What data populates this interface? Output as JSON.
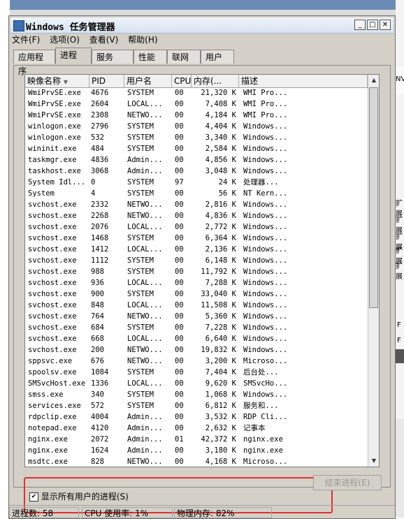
{
  "window": {
    "title": "Windows 任务管理器",
    "controls": {
      "minimize": "_",
      "maximize": "□",
      "close": "✕"
    }
  },
  "menu": [
    "文件(F)",
    "选项(O)",
    "查看(V)",
    "帮助(H)"
  ],
  "tabs": [
    "应用程序",
    "进程",
    "服务",
    "性能",
    "联网",
    "用户"
  ],
  "active_tab": "进程",
  "table": {
    "headers": [
      "映像名称",
      "PID",
      "用户名",
      "CPU",
      "内存(...",
      "描述"
    ],
    "rows": [
      [
        "WmiPrvSE.exe",
        "4676",
        "SYSTEM",
        "00",
        "21,320 K",
        "WMI Pro..."
      ],
      [
        "WmiPrvSE.exe",
        "2604",
        "LOCAL...",
        "00",
        "7,408 K",
        "WMI Pro..."
      ],
      [
        "WmiPrvSE.exe",
        "2308",
        "NETWO...",
        "00",
        "4,184 K",
        "WMI Pro..."
      ],
      [
        "winlogon.exe",
        "2796",
        "SYSTEM",
        "00",
        "4,404 K",
        "Windows..."
      ],
      [
        "winlogon.exe",
        "532",
        "SYSTEM",
        "00",
        "3,340 K",
        "Windows..."
      ],
      [
        "wininit.exe",
        "484",
        "SYSTEM",
        "00",
        "2,584 K",
        "Windows..."
      ],
      [
        "taskmgr.exe",
        "4836",
        "Admin...",
        "00",
        "4,856 K",
        "Windows..."
      ],
      [
        "taskhost.exe",
        "3068",
        "Admin...",
        "00",
        "3,048 K",
        "Windows..."
      ],
      [
        "System Idl...",
        "0",
        "SYSTEM",
        "97",
        "24 K",
        "处理器..."
      ],
      [
        "System",
        "4",
        "SYSTEM",
        "00",
        "56 K",
        "NT Kern..."
      ],
      [
        "svchost.exe",
        "2332",
        "NETWO...",
        "00",
        "2,816 K",
        "Windows..."
      ],
      [
        "svchost.exe",
        "2268",
        "NETWO...",
        "00",
        "4,836 K",
        "Windows..."
      ],
      [
        "svchost.exe",
        "2076",
        "LOCAL...",
        "00",
        "2,772 K",
        "Windows..."
      ],
      [
        "svchost.exe",
        "1468",
        "SYSTEM",
        "00",
        "6,364 K",
        "Windows..."
      ],
      [
        "svchost.exe",
        "1412",
        "LOCAL...",
        "00",
        "2,136 K",
        "Windows..."
      ],
      [
        "svchost.exe",
        "1112",
        "SYSTEM",
        "00",
        "6,148 K",
        "Windows..."
      ],
      [
        "svchost.exe",
        "988",
        "SYSTEM",
        "00",
        "11,792 K",
        "Windows..."
      ],
      [
        "svchost.exe",
        "936",
        "LOCAL...",
        "00",
        "7,288 K",
        "Windows..."
      ],
      [
        "svchost.exe",
        "900",
        "SYSTEM",
        "00",
        "33,040 K",
        "Windows..."
      ],
      [
        "svchost.exe",
        "848",
        "LOCAL...",
        "00",
        "11,508 K",
        "Windows..."
      ],
      [
        "svchost.exe",
        "764",
        "NETWO...",
        "00",
        "5,360 K",
        "Windows..."
      ],
      [
        "svchost.exe",
        "684",
        "SYSTEM",
        "00",
        "7,228 K",
        "Windows..."
      ],
      [
        "svchost.exe",
        "668",
        "LOCAL...",
        "00",
        "6,640 K",
        "Windows..."
      ],
      [
        "svchost.exe",
        "200",
        "NETWO...",
        "00",
        "19,832 K",
        "Windows..."
      ],
      [
        "sppsvc.exe",
        "676",
        "NETWO...",
        "00",
        "3,200 K",
        "Microso..."
      ],
      [
        "spoolsv.exe",
        "1084",
        "SYSTEM",
        "00",
        "7,404 K",
        "后台处..."
      ],
      [
        "SMSvcHost.exe",
        "1336",
        "LOCAL...",
        "00",
        "9,620 K",
        "SMSvcHo..."
      ],
      [
        "smss.exe",
        "340",
        "SYSTEM",
        "00",
        "1,068 K",
        "Windows..."
      ],
      [
        "services.exe",
        "572",
        "SYSTEM",
        "00",
        "6,812 K",
        "服务和..."
      ],
      [
        "rdpclip.exe",
        "4004",
        "Admin...",
        "00",
        "3,532 K",
        "RDP Cli..."
      ],
      [
        "notepad.exe",
        "4120",
        "Admin...",
        "00",
        "2,632 K",
        "记事本"
      ],
      [
        "nginx.exe",
        "2072",
        "Admin...",
        "01",
        "42,372 K",
        "nginx.exe"
      ],
      [
        "nginx.exe",
        "1624",
        "Admin...",
        "00",
        "3,180 K",
        "nginx.exe"
      ],
      [
        "msdtc.exe",
        "828",
        "NETWO...",
        "00",
        "4,168 K",
        "Microso..."
      ]
    ]
  },
  "show_all_users": {
    "label": "显示所有用户的进程(S)",
    "checked": true,
    "mark": "✔"
  },
  "end_process_label": "结束进程(E)",
  "status": {
    "process_count": "进程数: 58",
    "cpu_usage": "CPU 使用率: 1%",
    "physical_memory": "物理内存: 82%"
  },
  "background_fragments": [
    "NVI",
    "扩展",
    "扩展",
    "扩展",
    "扩展",
    "扩展",
    "F",
    "F"
  ],
  "highlight_color": "#e23030"
}
